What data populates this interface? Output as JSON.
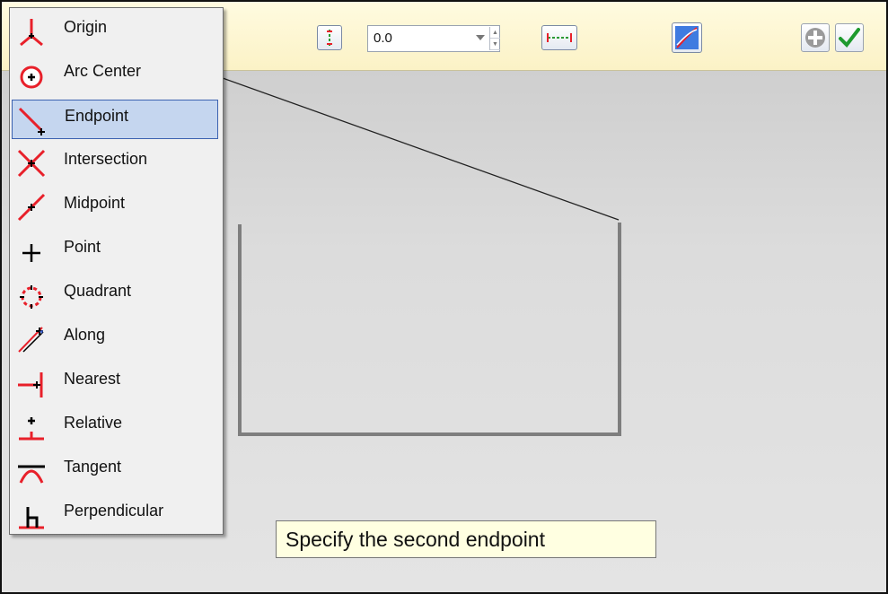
{
  "toolbar": {
    "value_field": {
      "value": "0.0"
    },
    "buttons": [
      "vertical-distance-icon",
      "horizontal-distance-icon",
      "curve-icon",
      "add-circle-icon",
      "checkmark-icon"
    ]
  },
  "snap_menu": {
    "selected": "Endpoint",
    "items": [
      {
        "label": "Origin",
        "icon": "origin-snap-icon"
      },
      {
        "label": "Arc Center",
        "icon": "arc-center-snap-icon"
      },
      {
        "label": "Endpoint",
        "icon": "endpoint-snap-icon"
      },
      {
        "label": "Intersection",
        "icon": "intersection-snap-icon"
      },
      {
        "label": "Midpoint",
        "icon": "midpoint-snap-icon"
      },
      {
        "label": "Point",
        "icon": "point-snap-icon"
      },
      {
        "label": "Quadrant",
        "icon": "quadrant-snap-icon"
      },
      {
        "label": "Along",
        "icon": "along-snap-icon"
      },
      {
        "label": "Nearest",
        "icon": "nearest-snap-icon"
      },
      {
        "label": "Relative",
        "icon": "relative-snap-icon"
      },
      {
        "label": "Tangent",
        "icon": "tangent-snap-icon"
      },
      {
        "label": "Perpendicular",
        "icon": "perpendicular-snap-icon"
      }
    ]
  },
  "tooltip": {
    "text": "Specify the second endpoint"
  },
  "colors": {
    "snap_red": "#e8202a",
    "menu_selection": "#c5d6ef",
    "tooltip_bg": "#ffffe1"
  }
}
